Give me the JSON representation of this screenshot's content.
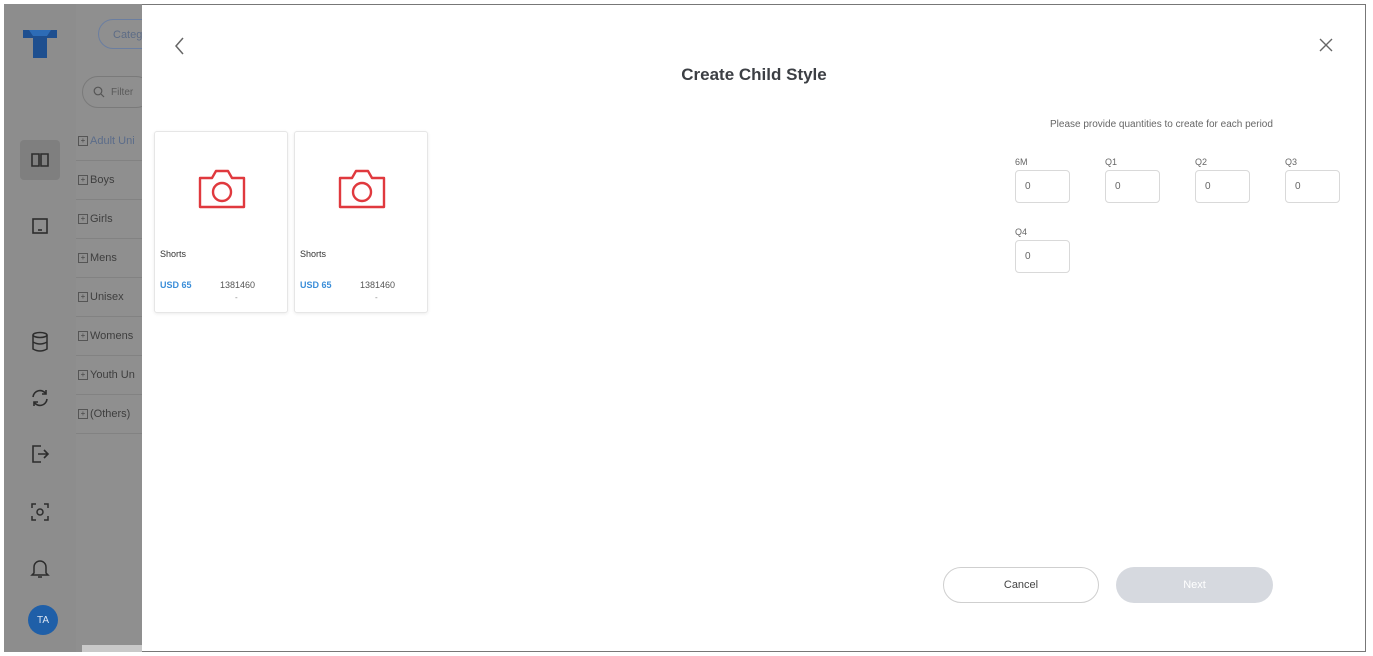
{
  "app": {
    "category_button": "Categ",
    "filter_placeholder": "Filter",
    "tree": [
      "Adult Uni",
      "Boys",
      "Girls",
      "Mens",
      "Unisex",
      "Womens",
      "Youth Un",
      "(Others)"
    ],
    "user_initials": "TA",
    "sidebar_icons": [
      "book-icon",
      "laptop-icon",
      "database-icon",
      "sync-icon",
      "export-icon",
      "scan-icon",
      "bell-icon"
    ]
  },
  "modal": {
    "title": "Create Child Style",
    "cards": [
      {
        "name": "Shorts",
        "price": "USD 65",
        "code": "1381460",
        "extra": "-"
      },
      {
        "name": "Shorts",
        "price": "USD 65",
        "code": "1381460",
        "extra": "-"
      }
    ],
    "quantities": {
      "instruction": "Please provide quantities to create for each period",
      "periods": [
        {
          "label": "6M",
          "value": "0"
        },
        {
          "label": "Q1",
          "value": "0"
        },
        {
          "label": "Q2",
          "value": "0"
        },
        {
          "label": "Q3",
          "value": "0"
        },
        {
          "label": "Q4",
          "value": "0"
        }
      ]
    },
    "buttons": {
      "cancel": "Cancel",
      "next": "Next"
    }
  },
  "colors": {
    "camera_icon": "#e0393e",
    "price_text": "#3b8ed8",
    "next_disabled": "#d6d9df",
    "avatar": "#1f5fa8"
  }
}
